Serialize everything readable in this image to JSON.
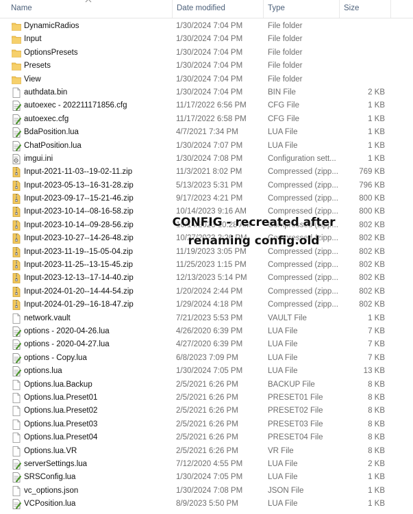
{
  "columns": {
    "name": "Name",
    "date": "Date modified",
    "type": "Type",
    "size": "Size"
  },
  "files": [
    {
      "name": "DynamicRadios",
      "date": "1/30/2024 7:04 PM",
      "type": "File folder",
      "size": "",
      "icon": "folder-icon"
    },
    {
      "name": "Input",
      "date": "1/30/2024 7:04 PM",
      "type": "File folder",
      "size": "",
      "icon": "folder-icon"
    },
    {
      "name": "OptionsPresets",
      "date": "1/30/2024 7:04 PM",
      "type": "File folder",
      "size": "",
      "icon": "folder-icon"
    },
    {
      "name": "Presets",
      "date": "1/30/2024 7:04 PM",
      "type": "File folder",
      "size": "",
      "icon": "folder-icon"
    },
    {
      "name": "View",
      "date": "1/30/2024 7:04 PM",
      "type": "File folder",
      "size": "",
      "icon": "folder-icon"
    },
    {
      "name": "authdata.bin",
      "date": "1/30/2024 7:04 PM",
      "type": "BIN File",
      "size": "2 KB",
      "icon": "file-icon"
    },
    {
      "name": "autoexec - 202211171856.cfg",
      "date": "11/17/2022 6:56 PM",
      "type": "CFG File",
      "size": "1 KB",
      "icon": "text-file-icon"
    },
    {
      "name": "autoexec.cfg",
      "date": "11/17/2022 6:58 PM",
      "type": "CFG File",
      "size": "1 KB",
      "icon": "text-file-icon"
    },
    {
      "name": "BdaPosition.lua",
      "date": "4/7/2021 7:34 PM",
      "type": "LUA File",
      "size": "1 KB",
      "icon": "text-file-icon"
    },
    {
      "name": "ChatPosition.lua",
      "date": "1/30/2024 7:07 PM",
      "type": "LUA File",
      "size": "1 KB",
      "icon": "text-file-icon"
    },
    {
      "name": "imgui.ini",
      "date": "1/30/2024 7:08 PM",
      "type": "Configuration sett...",
      "size": "1 KB",
      "icon": "config-file-icon"
    },
    {
      "name": "Input-2021-11-03--19-02-11.zip",
      "date": "11/3/2021 8:02 PM",
      "type": "Compressed (zipp...",
      "size": "769 KB",
      "icon": "zip-folder-icon"
    },
    {
      "name": "Input-2023-05-13--16-31-28.zip",
      "date": "5/13/2023 5:31 PM",
      "type": "Compressed (zipp...",
      "size": "796 KB",
      "icon": "zip-folder-icon"
    },
    {
      "name": "Input-2023-09-17--15-21-46.zip",
      "date": "9/17/2023 4:21 PM",
      "type": "Compressed (zipp...",
      "size": "800 KB",
      "icon": "zip-folder-icon"
    },
    {
      "name": "Input-2023-10-14--08-16-58.zip",
      "date": "10/14/2023 9:16 AM",
      "type": "Compressed (zipp...",
      "size": "800 KB",
      "icon": "zip-folder-icon"
    },
    {
      "name": "Input-2023-10-14--09-28-56.zip",
      "date": "10/14/2023 10:28 AM",
      "type": "Compressed (zipp...",
      "size": "802 KB",
      "icon": "zip-folder-icon"
    },
    {
      "name": "Input-2023-10-27--14-26-48.zip",
      "date": "10/27/2023 3:26 PM",
      "type": "Compressed (zipp...",
      "size": "802 KB",
      "icon": "zip-folder-icon"
    },
    {
      "name": "Input-2023-11-19--15-05-04.zip",
      "date": "11/19/2023 3:05 PM",
      "type": "Compressed (zipp...",
      "size": "802 KB",
      "icon": "zip-folder-icon"
    },
    {
      "name": "Input-2023-11-25--13-15-45.zip",
      "date": "11/25/2023 1:15 PM",
      "type": "Compressed (zipp...",
      "size": "802 KB",
      "icon": "zip-folder-icon"
    },
    {
      "name": "Input-2023-12-13--17-14-40.zip",
      "date": "12/13/2023 5:14 PM",
      "type": "Compressed (zipp...",
      "size": "802 KB",
      "icon": "zip-folder-icon"
    },
    {
      "name": "Input-2024-01-20--14-44-54.zip",
      "date": "1/20/2024 2:44 PM",
      "type": "Compressed (zipp...",
      "size": "802 KB",
      "icon": "zip-folder-icon"
    },
    {
      "name": "Input-2024-01-29--16-18-47.zip",
      "date": "1/29/2024 4:18 PM",
      "type": "Compressed (zipp...",
      "size": "802 KB",
      "icon": "zip-folder-icon"
    },
    {
      "name": "network.vault",
      "date": "7/21/2023 5:53 PM",
      "type": "VAULT File",
      "size": "1 KB",
      "icon": "file-icon"
    },
    {
      "name": "options - 2020-04-26.lua",
      "date": "4/26/2020 6:39 PM",
      "type": "LUA File",
      "size": "7 KB",
      "icon": "text-file-icon"
    },
    {
      "name": "options - 2020-04-27.lua",
      "date": "4/27/2020 6:39 PM",
      "type": "LUA File",
      "size": "7 KB",
      "icon": "text-file-icon"
    },
    {
      "name": "options - Copy.lua",
      "date": "6/8/2023 7:09 PM",
      "type": "LUA File",
      "size": "7 KB",
      "icon": "text-file-icon"
    },
    {
      "name": "options.lua",
      "date": "1/30/2024 7:05 PM",
      "type": "LUA File",
      "size": "13 KB",
      "icon": "text-file-icon"
    },
    {
      "name": "Options.lua.Backup",
      "date": "2/5/2021 6:26 PM",
      "type": "BACKUP File",
      "size": "8 KB",
      "icon": "file-icon"
    },
    {
      "name": "Options.lua.Preset01",
      "date": "2/5/2021 6:26 PM",
      "type": "PRESET01 File",
      "size": "8 KB",
      "icon": "file-icon"
    },
    {
      "name": "Options.lua.Preset02",
      "date": "2/5/2021 6:26 PM",
      "type": "PRESET02 File",
      "size": "8 KB",
      "icon": "file-icon"
    },
    {
      "name": "Options.lua.Preset03",
      "date": "2/5/2021 6:26 PM",
      "type": "PRESET03 File",
      "size": "8 KB",
      "icon": "file-icon"
    },
    {
      "name": "Options.lua.Preset04",
      "date": "2/5/2021 6:26 PM",
      "type": "PRESET04 File",
      "size": "8 KB",
      "icon": "file-icon"
    },
    {
      "name": "Options.lua.VR",
      "date": "2/5/2021 6:26 PM",
      "type": "VR File",
      "size": "8 KB",
      "icon": "file-icon"
    },
    {
      "name": "serverSettings.lua",
      "date": "7/12/2020 4:55 PM",
      "type": "LUA File",
      "size": "2 KB",
      "icon": "text-file-icon"
    },
    {
      "name": "SRSConfig.lua",
      "date": "1/30/2024 7:05 PM",
      "type": "LUA File",
      "size": "1 KB",
      "icon": "text-file-icon"
    },
    {
      "name": "vc_options.json",
      "date": "1/30/2024 7:08 PM",
      "type": "JSON File",
      "size": "1 KB",
      "icon": "file-icon"
    },
    {
      "name": "VCPosition.lua",
      "date": "8/9/2023 5:50 PM",
      "type": "LUA File",
      "size": "1 KB",
      "icon": "text-file-icon"
    }
  ],
  "annotation": {
    "line1": "CONFIG - recreated after",
    "line2": "renaming config.old"
  },
  "colors": {
    "folder": "#e8b948",
    "header_text": "#4c607a",
    "secondary_text": "#6d6d6d"
  }
}
